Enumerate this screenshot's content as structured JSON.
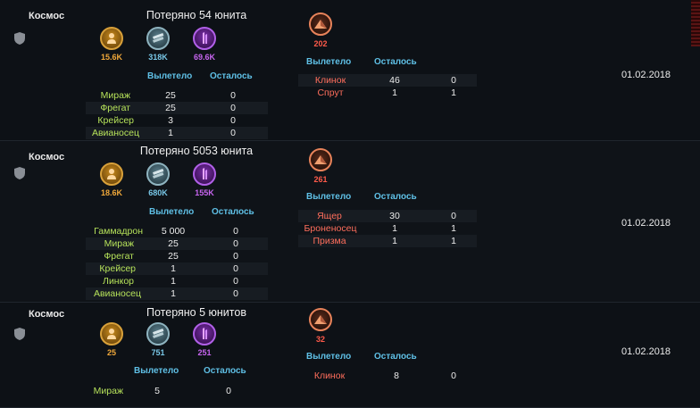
{
  "battles": [
    {
      "location": "Космос",
      "lost_title": "Потеряно 54 юнита",
      "resources": [
        {
          "icon": "gold-person-icon",
          "value": "15.6K",
          "kind": "gold"
        },
        {
          "icon": "silver-bars-icon",
          "value": "318K",
          "kind": "silver"
        },
        {
          "icon": "purple-crystal-icon",
          "value": "69.6K",
          "kind": "purple"
        }
      ],
      "own_headers": {
        "sent": "Вылетело",
        "left": "Осталось"
      },
      "own_units": [
        {
          "name": "Мираж",
          "sent": "25",
          "left": "0"
        },
        {
          "name": "Фрегат",
          "sent": "25",
          "left": "0"
        },
        {
          "name": "Крейсер",
          "sent": "3",
          "left": "0"
        },
        {
          "name": "Авианосец",
          "sent": "1",
          "left": "0"
        }
      ],
      "enemy_value": "202",
      "enemy_headers": {
        "sent": "Вылетело",
        "left": "Осталось"
      },
      "enemy_units": [
        {
          "name": "Клинок",
          "sent": "46",
          "left": "0"
        },
        {
          "name": "Спрут",
          "sent": "1",
          "left": "1"
        }
      ],
      "date": "01.02.2018"
    },
    {
      "location": "Космос",
      "lost_title": "Потеряно 5053 юнита",
      "resources": [
        {
          "icon": "gold-person-icon",
          "value": "18.6K",
          "kind": "gold"
        },
        {
          "icon": "silver-bars-icon",
          "value": "680K",
          "kind": "silver"
        },
        {
          "icon": "purple-crystal-icon",
          "value": "155K",
          "kind": "purple"
        }
      ],
      "own_headers": {
        "sent": "Вылетело",
        "left": "Осталось"
      },
      "own_units": [
        {
          "name": "Гаммадрон",
          "sent": "5 000",
          "left": "0"
        },
        {
          "name": "Мираж",
          "sent": "25",
          "left": "0"
        },
        {
          "name": "Фрегат",
          "sent": "25",
          "left": "0"
        },
        {
          "name": "Крейсер",
          "sent": "1",
          "left": "0"
        },
        {
          "name": "Линкор",
          "sent": "1",
          "left": "0"
        },
        {
          "name": "Авианосец",
          "sent": "1",
          "left": "0"
        }
      ],
      "enemy_value": "261",
      "enemy_headers": {
        "sent": "Вылетело",
        "left": "Осталось"
      },
      "enemy_units": [
        {
          "name": "Ящер",
          "sent": "30",
          "left": "0"
        },
        {
          "name": "Броненосец",
          "sent": "1",
          "left": "1"
        },
        {
          "name": "Призма",
          "sent": "1",
          "left": "1"
        }
      ],
      "date": "01.02.2018"
    },
    {
      "location": "Космос",
      "lost_title": "Потеряно 5 юнитов",
      "resources": [
        {
          "icon": "gold-person-icon",
          "value": "25",
          "kind": "gold"
        },
        {
          "icon": "silver-bars-icon",
          "value": "751",
          "kind": "silver"
        },
        {
          "icon": "purple-crystal-icon",
          "value": "251",
          "kind": "purple"
        }
      ],
      "own_headers": {
        "sent": "Вылетело",
        "left": "Осталось"
      },
      "own_units": [
        {
          "name": "Мираж",
          "sent": "5",
          "left": "0"
        }
      ],
      "enemy_value": "32",
      "enemy_headers": {
        "sent": "Вылетело",
        "left": "Осталось"
      },
      "enemy_units": [
        {
          "name": "Клинок",
          "sent": "8",
          "left": "0"
        }
      ],
      "date": "01.02.2018"
    }
  ]
}
